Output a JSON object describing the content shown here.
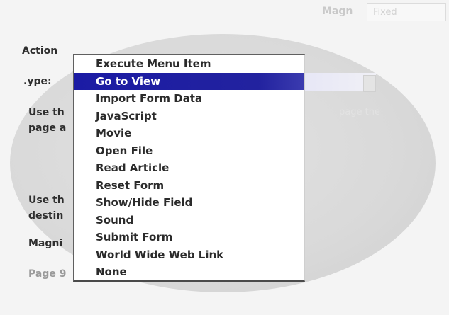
{
  "header": {
    "field_label": "Magn",
    "field_value": "Fixed"
  },
  "action_panel": {
    "section_label": "Action",
    "type_label": ".ype:",
    "use_the_1": "Use th",
    "page_a": "page a",
    "use_the_2": "Use th",
    "destin": "destin",
    "magni": "Magni",
    "bottom_label": "Page 9",
    "faded_right": "page the"
  },
  "menu": {
    "items": [
      {
        "label": "Execute Menu Item",
        "selected": false
      },
      {
        "label": "Go to View",
        "selected": true
      },
      {
        "label": "Import Form Data",
        "selected": false
      },
      {
        "label": "JavaScript",
        "selected": false
      },
      {
        "label": "Movie",
        "selected": false
      },
      {
        "label": "Open File",
        "selected": false
      },
      {
        "label": "Read Article",
        "selected": false
      },
      {
        "label": "Reset Form",
        "selected": false
      },
      {
        "label": "Show/Hide Field",
        "selected": false
      },
      {
        "label": "Sound",
        "selected": false
      },
      {
        "label": "Submit Form",
        "selected": false
      },
      {
        "label": "World Wide Web Link",
        "selected": false
      },
      {
        "label": "None",
        "selected": false
      }
    ]
  }
}
